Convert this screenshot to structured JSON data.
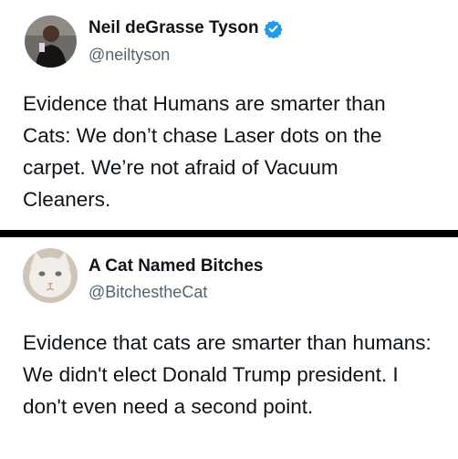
{
  "tweets": [
    {
      "display_name": "Neil deGrasse Tyson",
      "verified": true,
      "handle": "@neiltyson",
      "text": "Evidence that Humans are smarter than Cats:  We don’t chase Laser dots on the carpet. We’re not afraid of Vacuum Cleaners."
    },
    {
      "display_name": "A Cat Named Bitches",
      "verified": false,
      "handle": "@BitchestheCat",
      "text": "Evidence that cats are smarter than humans: We didn't elect Donald Trump president. I don't even need a second point."
    }
  ],
  "colors": {
    "text": "#0f1419",
    "handle": "#536471",
    "verified_badge": "#1d9bf0",
    "divider": "#000000"
  }
}
